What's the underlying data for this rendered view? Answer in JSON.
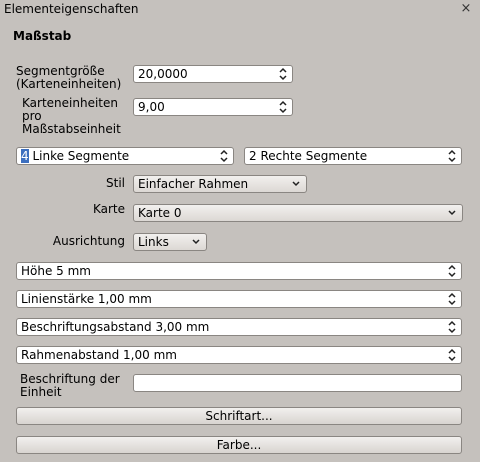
{
  "window": {
    "title": "Elementeigenschaften",
    "close": "×"
  },
  "section": {
    "title": "Maßstab"
  },
  "segment_size": {
    "label_line1": "Segmentgröße",
    "label_line2": "(Karteneinheiten)",
    "value": "20,0000"
  },
  "map_units": {
    "label_line1": "Karteneinheiten",
    "label_line2": "pro",
    "label_line3": "Maßstabseinheit",
    "value": "9,00"
  },
  "left_segments": {
    "number": "4",
    "text": " Linke Segmente"
  },
  "right_segments": {
    "value": "2 Rechte Segmente"
  },
  "style": {
    "label": "Stil",
    "value": "Einfacher Rahmen"
  },
  "map": {
    "label": "Karte",
    "value": "Karte 0"
  },
  "alignment": {
    "label": "Ausrichtung",
    "value": "Links"
  },
  "height": {
    "value": "Höhe 5 mm"
  },
  "line_width": {
    "value": "Linienstärke 1,00 mm"
  },
  "label_spacing": {
    "value": "Beschriftungsabstand 3,00 mm"
  },
  "frame_spacing": {
    "value": "Rahmenabstand 1,00 mm"
  },
  "unit_label": {
    "label_line1": "Beschriftung der",
    "label_line2": "Einheit",
    "value": ""
  },
  "buttons": {
    "font": "Schriftart...",
    "color": "Farbe..."
  }
}
